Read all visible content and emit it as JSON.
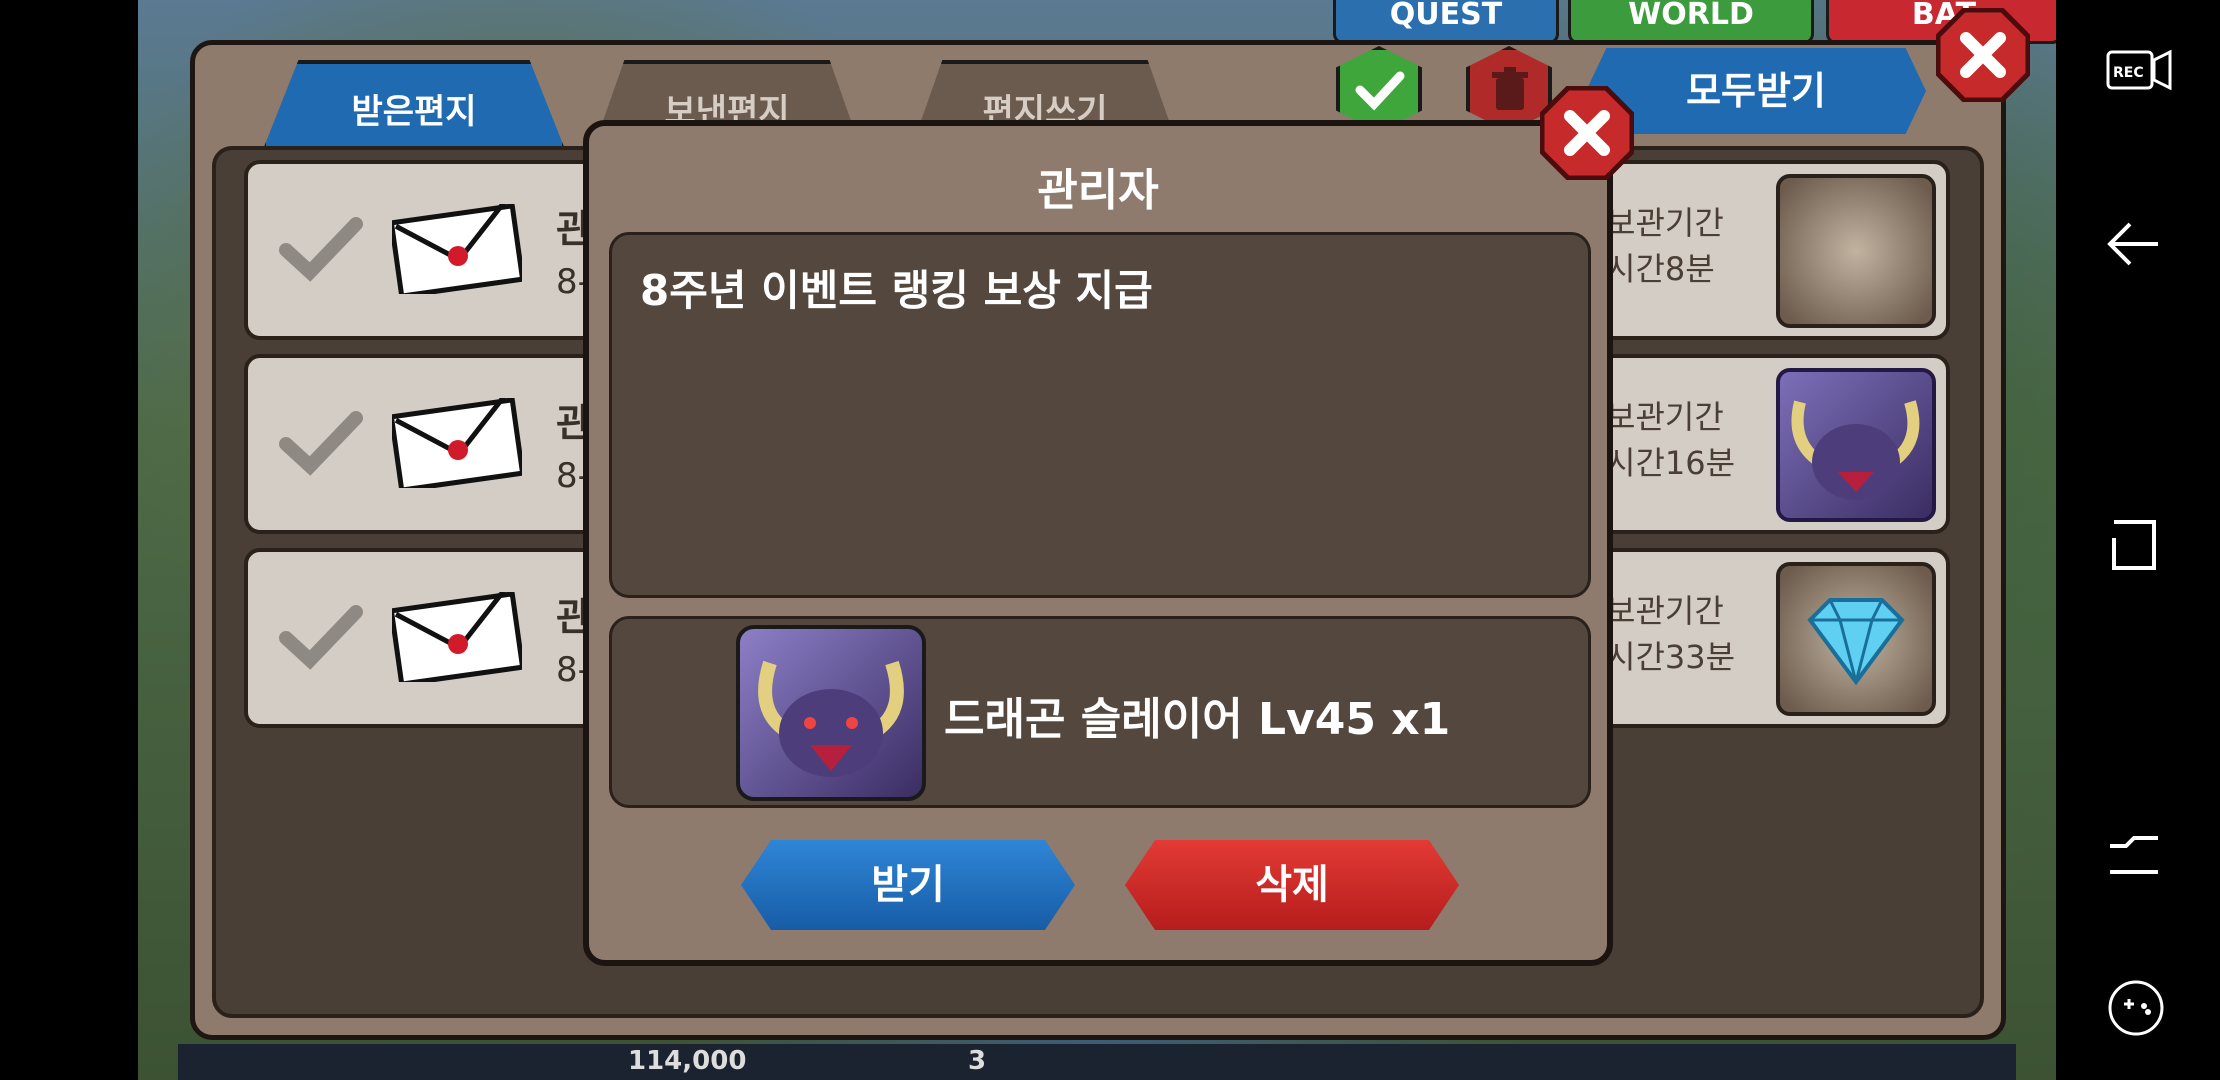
{
  "background": {
    "tabs": [
      "QUEST",
      "WORLD",
      "BAT"
    ],
    "gold": "114,000",
    "gems": "3"
  },
  "mailbox": {
    "tabs": {
      "received": "받은편지",
      "sent": "보낸편지",
      "write": "편지쓰기"
    },
    "receive_all_label": "모두받기",
    "rows": [
      {
        "sender": "관",
        "date": "8-",
        "keep_label": "보관기간",
        "remain": "시간8분",
        "icon": "burst-placeholder-icon"
      },
      {
        "sender": "관",
        "date": "8-",
        "keep_label": "보관기간",
        "remain": "시간16분",
        "icon": "dragon-portrait-icon"
      },
      {
        "sender": "관",
        "date": "8-",
        "keep_label": "보관기간",
        "remain": "시간33분",
        "icon": "diamond-icon"
      }
    ]
  },
  "dialog": {
    "title": "관리자",
    "message": "8주년 이벤트 랭킹 보상 지급",
    "reward_text": "드래곤 슬레이어 Lv45 x1",
    "receive_label": "받기",
    "delete_label": "삭제"
  },
  "colors": {
    "blue_button": "#1f6ab1",
    "red_button": "#c8282f",
    "panel_brown": "#8f7b6d",
    "box_dark": "#54473e"
  }
}
